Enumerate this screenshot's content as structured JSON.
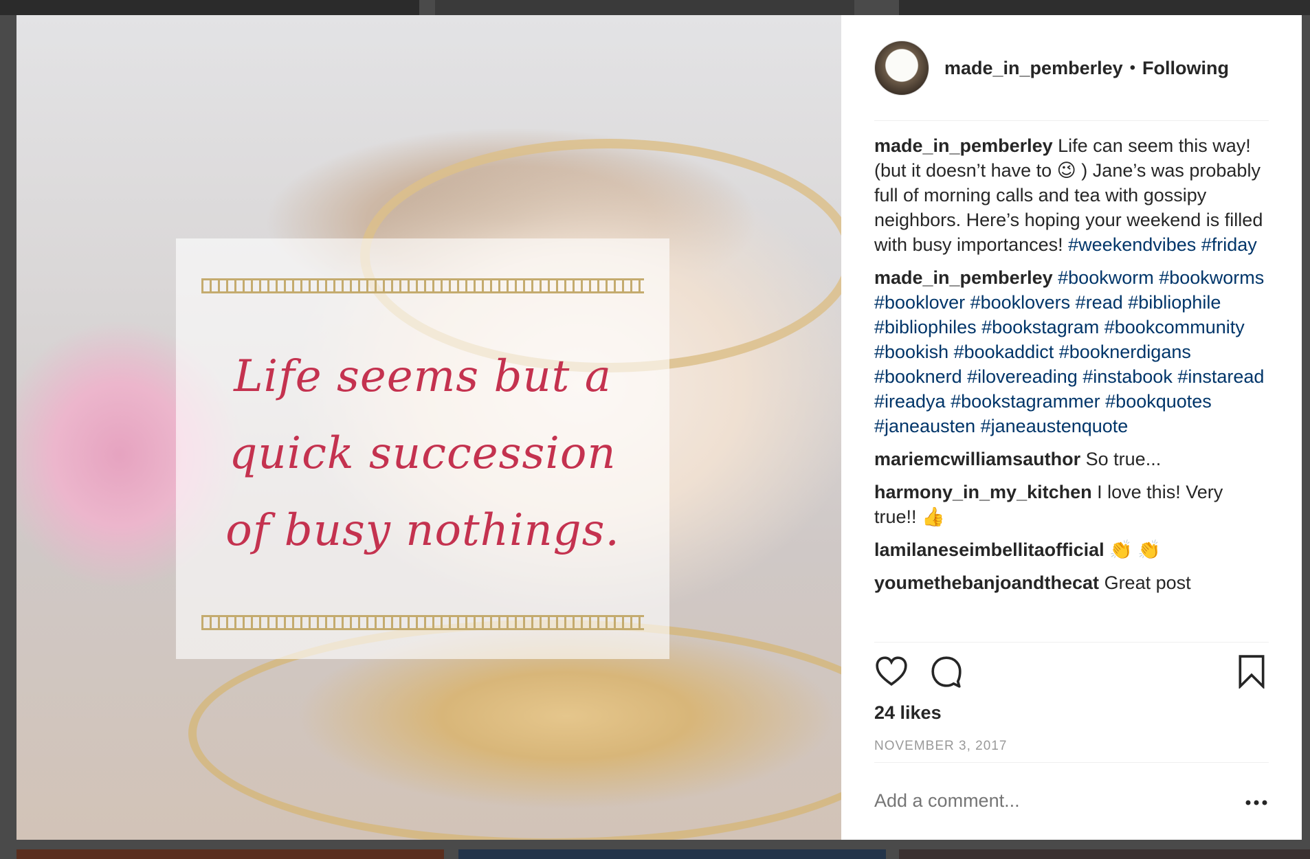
{
  "post": {
    "quote": "Life seems but a quick succession of busy nothings."
  },
  "header": {
    "username": "made_in_pemberley",
    "separator": "•",
    "follow_status": "Following"
  },
  "comments": [
    {
      "author": "made_in_pemberley",
      "text": "Life can seem this way! (but it doesn’t have to 😉 ) Jane’s was probably full of morning calls and tea with gossipy neighbors. Here’s hoping your weekend is filled with busy importances!",
      "tags": "#weekendvibes #friday"
    },
    {
      "author": "made_in_pemberley",
      "text": "",
      "tags": "#bookworm #bookworms #booklover #booklovers #read #bibliophile #bibliophiles #bookstagram #bookcommunity #bookish #bookaddict #booknerdigans #booknerd #ilovereading #instabook #instaread #ireadya #bookstagrammer #bookquotes #janeausten #janeaustenquote"
    },
    {
      "author": "mariemcwilliamsauthor",
      "text": "So true...",
      "tags": ""
    },
    {
      "author": "harmony_in_my_kitchen",
      "text": "I love this! Very true!! 👍",
      "tags": ""
    },
    {
      "author": "lamilaneseimbellitaofficial",
      "text": "👏 👏",
      "tags": ""
    },
    {
      "author": "youmethebanjoandthecat",
      "text": "Great post",
      "tags": ""
    }
  ],
  "stats": {
    "likes": "24 likes",
    "date": "NOVEMBER 3, 2017"
  },
  "composer": {
    "placeholder": "Add a comment..."
  },
  "icons": [
    "heart-icon",
    "comment-icon",
    "bookmark-icon",
    "more-icon"
  ],
  "colors": {
    "quote_text": "#c4324f",
    "hashtag": "#003569",
    "muted": "#999999"
  }
}
